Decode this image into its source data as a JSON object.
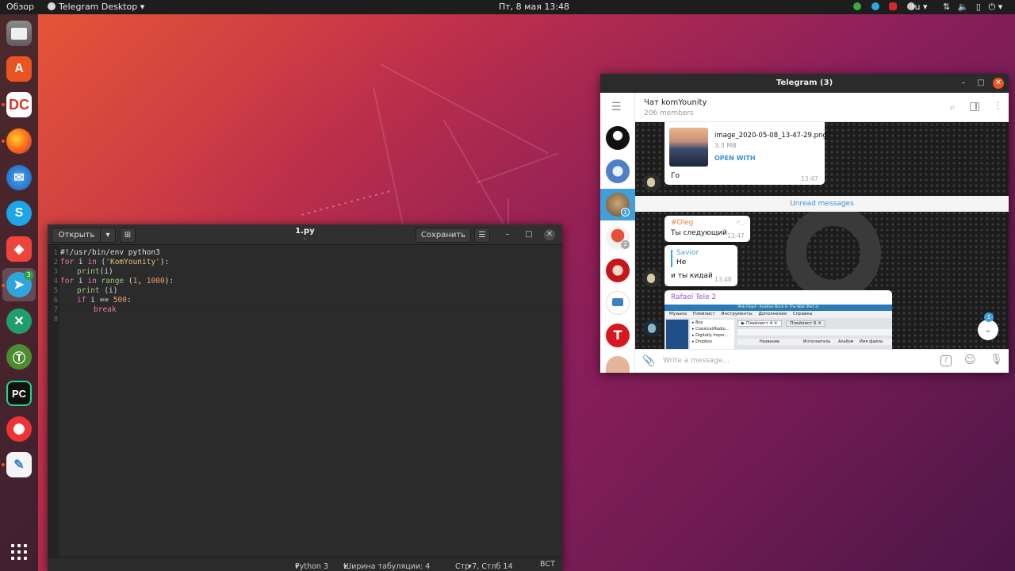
{
  "topbar": {
    "overview": "Обзор",
    "app_menu": "Telegram Desktop",
    "clock": "Пт, 8 мая  13:48",
    "lang": "ru"
  },
  "dock": {
    "telegram_badge": "3",
    "apps": [
      "Files",
      "Ubuntu Software",
      "DC++",
      "Firefox",
      "Thunderbird",
      "Skype",
      "AnyDesk",
      "Telegram",
      "Remote Desktop",
      "Tor Browser",
      "PyCharm",
      "Lifesaver",
      "Text Editor"
    ]
  },
  "gedit": {
    "open_label": "Открыть",
    "title": "1.py",
    "subtitle": "~",
    "save_label": "Сохранить",
    "line_numbers": [
      "1",
      "2",
      "3",
      "4",
      "5",
      "6",
      "7",
      "8"
    ],
    "code": {
      "l1": "#!/usr/bin/env python3",
      "l2_kw": "for",
      "l2_var": " i ",
      "l2_in": "in",
      "l2_rest": " (",
      "l2_str": "'KomYounity'",
      "l2_end": "):",
      "l3_fn": "print",
      "l3_rest": "(i)",
      "l4_kw": "for",
      "l4_var": " i ",
      "l4_in": "in",
      "l4_sp": " ",
      "l4_fn": "range",
      "l4_open": " (",
      "l4_n1": "1",
      "l4_comma": ", ",
      "l4_n2": "1000",
      "l4_end": "):",
      "l5_fn": "print",
      "l5_rest": " (i)",
      "l6_kw": "if",
      "l6_rest": " i == ",
      "l6_num": "500",
      "l6_end": ":",
      "l7_kw": "break"
    },
    "status": {
      "language": "Python 3",
      "tab_width": "Ширина табуляции: 4",
      "position": "Стр 7, Стлб 14",
      "mode": "ВСТ"
    }
  },
  "telegram": {
    "window_title": "Telegram (3)",
    "chat_name": "Чат komYounity",
    "members": "206 members",
    "chat_list_badges": [
      "1",
      "2"
    ],
    "messages": {
      "file_name": "image_2020-05-08_13-47-29.png",
      "file_size": "3.3 MB",
      "open_with": "OPEN WITH",
      "file_caption": "Го",
      "file_time": "13:47",
      "unread_label": "Unread messages",
      "m1_author": "#Oleg",
      "m1_text": "Ты следующий",
      "m1_time": "13:47",
      "m2_reply_author": "Savior",
      "m2_reply_text": "Не",
      "m2_text": "и ты кидай",
      "m2_time": "13:48",
      "m3_author": "Rafael Tele 2",
      "m3_preview_title": "Pink Floyd - Another Brick In The Wall (Part 2)",
      "m3_menu": [
        "Музыка",
        "Плейлист",
        "Инструменты",
        "Дополнения",
        "Справка"
      ],
      "m3_tabs": [
        "Плейлист 4",
        "Плейлист 6"
      ],
      "m3_rows": [
        "Box",
        "Classical/Radio...",
        "Digitally Impor...",
        "Dropbox"
      ],
      "m3_cols": [
        "Название",
        "Исполнитель",
        "Альбом",
        "Имя файла"
      ]
    },
    "scroll_badge": "1",
    "input_placeholder": "Write a message..."
  }
}
